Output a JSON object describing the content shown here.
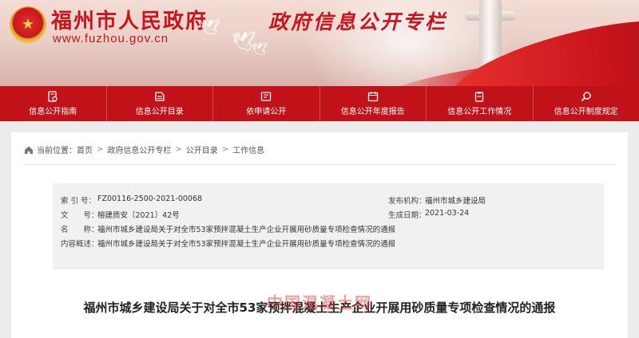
{
  "header": {
    "site_title": "福州市人民政府",
    "site_url": "www.fuzhou.gov.cn",
    "column_title": "政府信息公开专栏"
  },
  "nav": {
    "items": [
      {
        "label": "信息公开指南",
        "icon": "document-info-icon"
      },
      {
        "label": "信息公开目录",
        "icon": "folder-list-icon"
      },
      {
        "label": "依申请公开",
        "icon": "apply-form-icon"
      },
      {
        "label": "信息公开年度报告",
        "icon": "calendar-report-icon"
      },
      {
        "label": "信息公开工作情况",
        "icon": "clipboard-icon"
      },
      {
        "label": "信息公开制度规定",
        "icon": "search-rules-icon"
      }
    ]
  },
  "breadcrumb": {
    "prefix": "当前位置：",
    "items": [
      "首页",
      "政府信息公开专栏",
      "公开目录",
      "工作信息"
    ]
  },
  "meta": {
    "index_label": "索 引 号：",
    "index_value": "FZ00116-2500-2021-00068",
    "org_label": "发布机构：",
    "org_value": "福州市城乡建设局",
    "docno_label": "文　　号：",
    "docno_value": "榕建质安〔2021〕42号",
    "date_label": "生成日期：",
    "date_value": "2021-03-24",
    "name_label": "名　　称：",
    "name_value": "福州市城乡建设局关于对全市53家预拌混凝土生产企业开展用砂质量专项检查情况的通报",
    "summary_label": "内容概述：",
    "summary_value": "福州市城乡建设局关于对全市53家预拌混凝土生产企业开展用砂质量专项检查情况的通报"
  },
  "document": {
    "title": "福州市城乡建设局关于对全市53家预拌混凝土生产企业开展用砂质量专项检查情况的通报"
  },
  "watermark": "中国混凝土网",
  "colors": {
    "brand_red": "#c1121a",
    "banner_bg": "#ead0c8",
    "page_bg": "#ececec"
  }
}
